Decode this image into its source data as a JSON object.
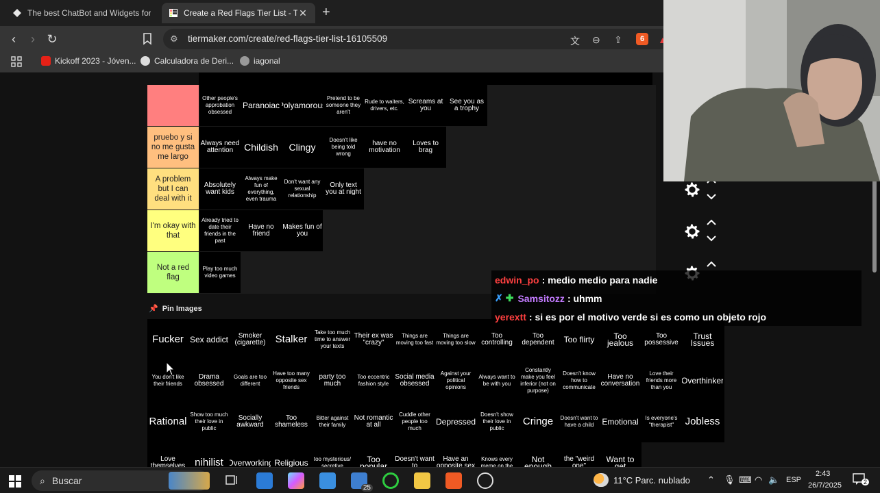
{
  "browser": {
    "tabs": [
      {
        "title": "The best ChatBot and Widgets for Ki",
        "active": false
      },
      {
        "title": "Create a Red Flags Tier List - Tier",
        "active": true
      }
    ],
    "url": "tiermaker.com/create/red-flags-tier-list-16105509",
    "bookmarks": [
      "Kickoff 2023 - Jóven...",
      "Calculadora de Deri...",
      "iagonal"
    ],
    "brave_badge": "6"
  },
  "tiers": [
    {
      "label": "",
      "color": "#ff7f7f",
      "items": [
        "Other people's approbation obsessed",
        "Paranoiac",
        "Polyamorous",
        "Pretend to be someone they aren't",
        "Rude to waiters, drivers, etc.",
        "Screams at you",
        "See you as a trophy"
      ]
    },
    {
      "label": "pruebo y si no me gusta me largo",
      "color": "#ffbf7f",
      "items": [
        "Always need attention",
        "Childish",
        "Clingy",
        "Doesn't like being told wrong",
        "have no motivation",
        "Loves to brag"
      ]
    },
    {
      "label": "A problem but I can deal with it",
      "color": "#ffdf7f",
      "items": [
        "Absolutely want kids",
        "Always make fun of everything, even trauma",
        "Don't want any sexual relationship",
        "Only text you at night"
      ]
    },
    {
      "label": "I'm okay with that",
      "color": "#ffff7f",
      "items": [
        "Already tried to date their friends in the past",
        "Have no friend",
        "Makes fun of you"
      ]
    },
    {
      "label": "Not a red flag",
      "color": "#bfff7f",
      "items": [
        "Play too much video games"
      ]
    }
  ],
  "pin_images_label": "Pin Images",
  "pool_items": [
    "Fucker",
    "Sex addict",
    "Smoker (cigarette)",
    "Stalker",
    "Take too much time to answer your texts",
    "Their ex was \"crazy\"",
    "Things are moving too fast",
    "Things are moving too slow",
    "Too controlling",
    "Too dependent",
    "Too flirty",
    "Too jealous",
    "Too possessive",
    "Trust Issues",
    "You don't like their friends",
    "Drama obsessed",
    "Goals are too different",
    "Have too many opposite sex friends",
    "party too much",
    "Too eccentric fashion style",
    "Social media obsessed",
    "Against your political opinions",
    "Always want to be with you",
    "Constantly make you feel inferior (not on purpose)",
    "Doesn't know how to communicate",
    "Have no conversation",
    "Love their friends more than you",
    "Overthinker",
    "Rational",
    "Show too much their love in public",
    "Socially awkward",
    "Too shameless",
    "Bitter against their family",
    "Not romantic at all",
    "Cuddle other people too much",
    "Depressed",
    "Doesn't show their love in public",
    "Cringe",
    "Doesn't want to have a child",
    "Emotional",
    "Is everyone's \"therapist\"",
    "Jobless",
    "Love themselves",
    "nihilist",
    "Overworking",
    "Religious",
    "too mysterious/ secretive",
    "Too popular",
    "Doesn't want to",
    "Have an opposite sex",
    "Knows every meme on the",
    "Not enough",
    "the \"weird one\"",
    "Want to get",
    "",
    ""
  ],
  "chat": [
    {
      "user": "edwin_po",
      "user_color": "#ff4040",
      "message": ": medio medio para nadie",
      "badges": false
    },
    {
      "user": "Samsitozz",
      "user_color": "#c37bff",
      "message": ": uhmm",
      "badges": true
    },
    {
      "user": "yerextt",
      "user_color": "#ff4040",
      "message": ": si es por el motivo verde si es como un objeto rojo",
      "badges": false
    }
  ],
  "taskbar": {
    "search_label": "Buscar",
    "mail_badge": "25",
    "weather": "11°C  Parc. nublado",
    "language": "ESP",
    "time": "2:43",
    "date": "26/7/2025",
    "notification_count": "2"
  }
}
